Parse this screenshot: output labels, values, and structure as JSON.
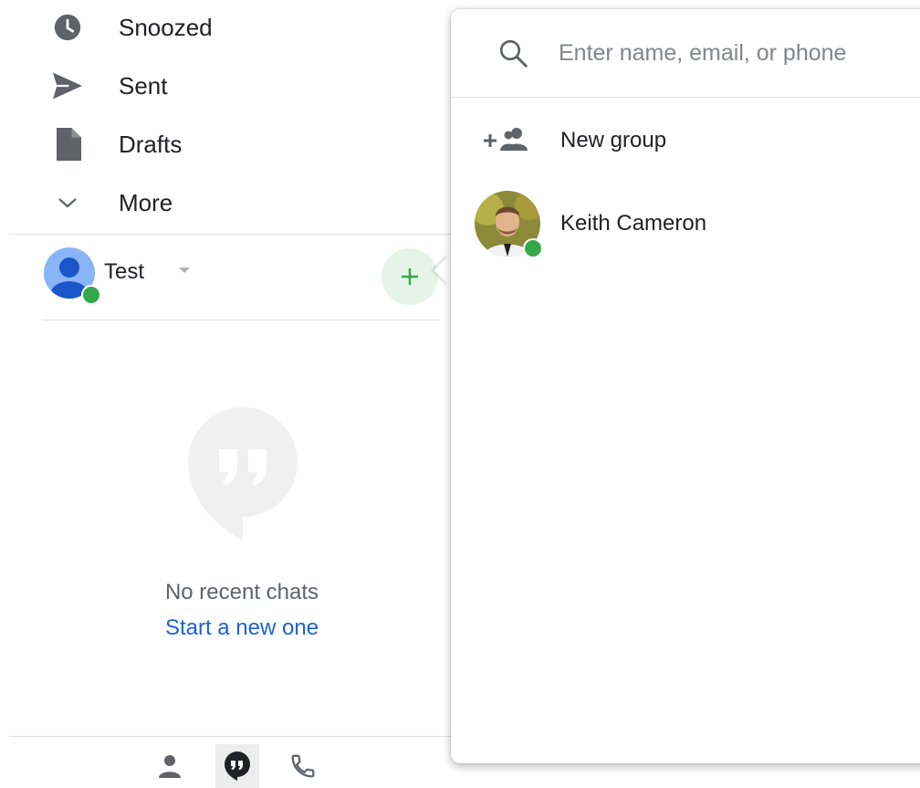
{
  "nav": {
    "items": [
      {
        "label": "Snoozed",
        "icon": "clock-icon"
      },
      {
        "label": "Sent",
        "icon": "send-icon"
      },
      {
        "label": "Drafts",
        "icon": "draft-icon"
      },
      {
        "label": "More",
        "icon": "chevron-down-icon"
      }
    ]
  },
  "hangouts": {
    "user_name": "Test",
    "presence_color": "#35a94a",
    "empty_title": "No recent chats",
    "empty_link": "Start a new one"
  },
  "bottom_tabs": [
    {
      "name": "contacts",
      "icon": "person-icon",
      "active": false
    },
    {
      "name": "chats",
      "icon": "hangouts-icon",
      "active": true
    },
    {
      "name": "phone",
      "icon": "phone-icon",
      "active": false
    }
  ],
  "popup": {
    "search_placeholder": "Enter name, email, or phone",
    "new_group_label": "New group",
    "contacts": [
      {
        "name": "Keith Cameron",
        "online": true
      }
    ]
  },
  "colors": {
    "accent_green": "#35a94a",
    "link_blue": "#1a63d6"
  }
}
